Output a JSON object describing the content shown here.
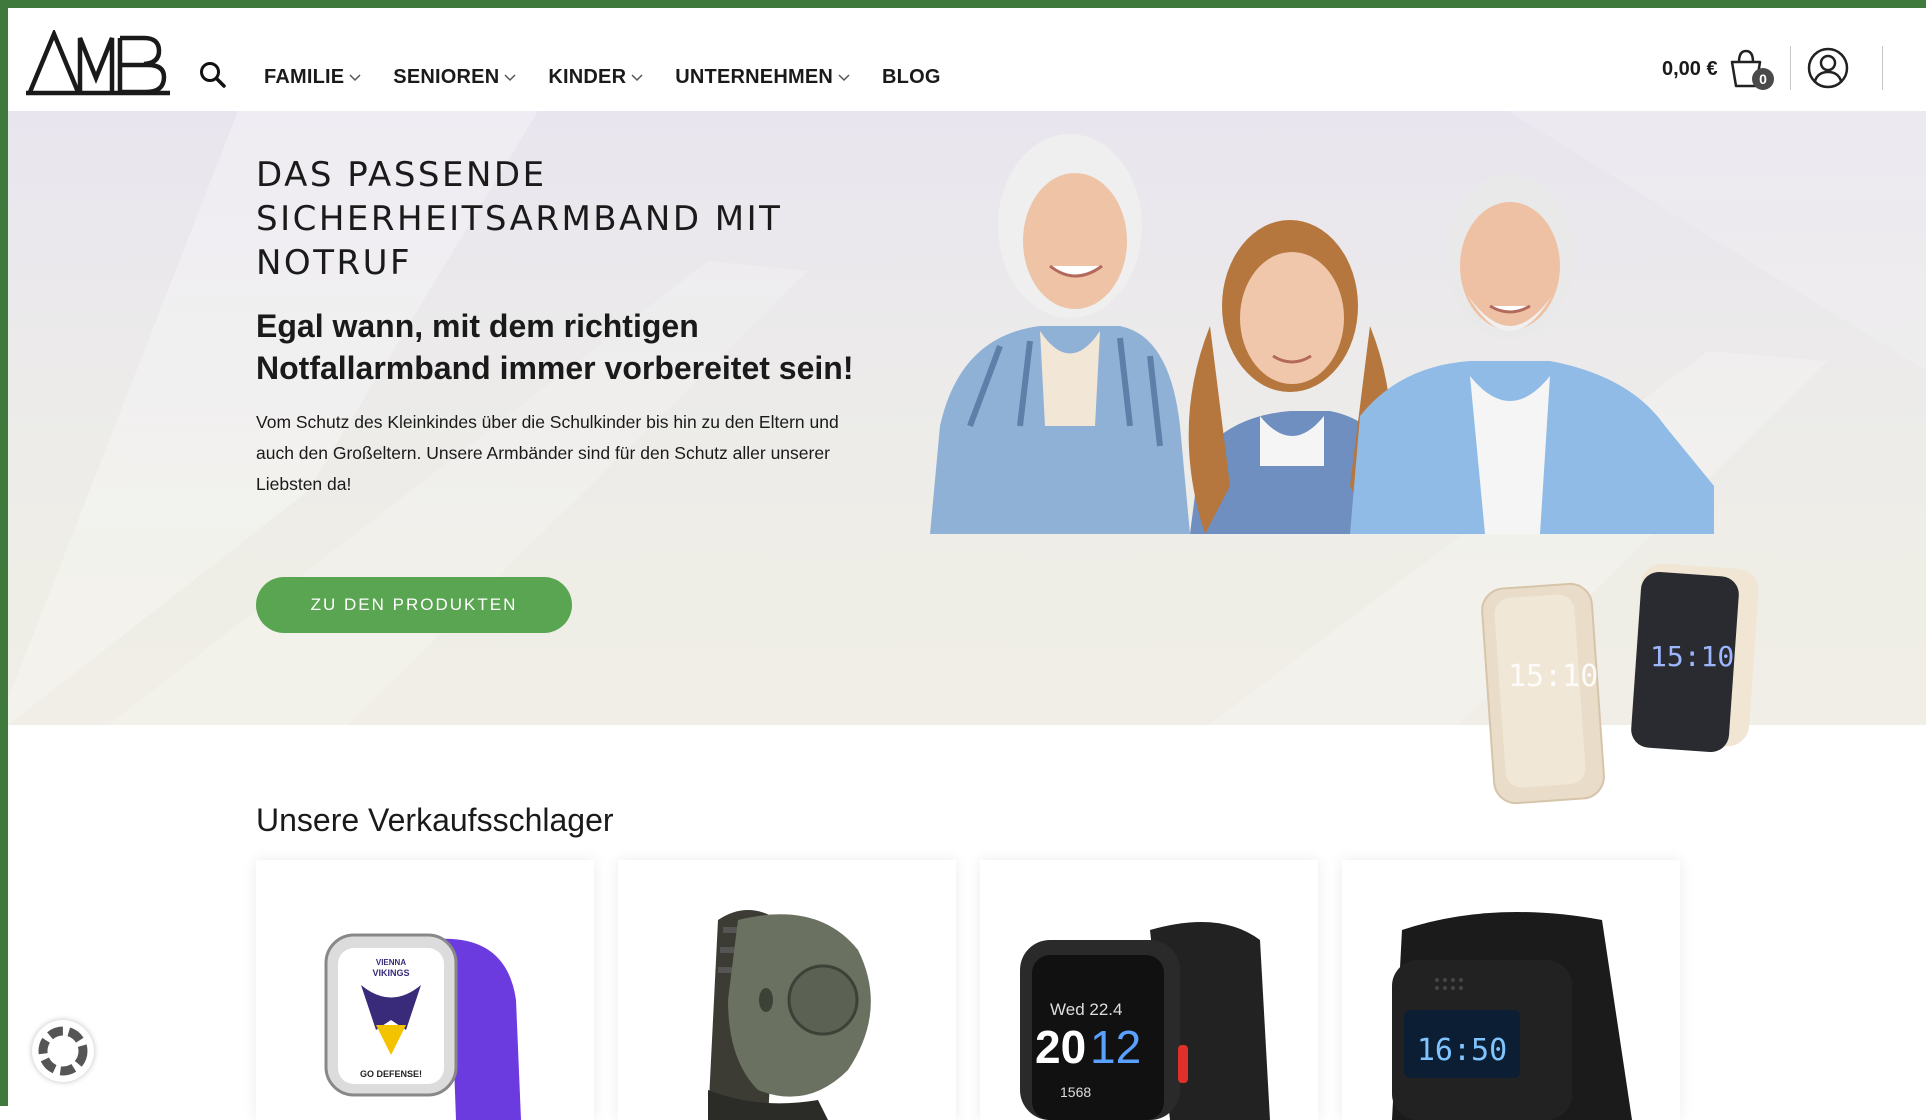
{
  "header": {
    "logo_text": "AMB",
    "nav": [
      {
        "label": "FAMILIE",
        "has_dropdown": true
      },
      {
        "label": "SENIOREN",
        "has_dropdown": true
      },
      {
        "label": "KINDER",
        "has_dropdown": true
      },
      {
        "label": "UNTERNEHMEN",
        "has_dropdown": true
      },
      {
        "label": "BLOG",
        "has_dropdown": false
      }
    ],
    "cart": {
      "price": "0,00 €",
      "count": "0",
      "icon": "cart-icon"
    },
    "account_icon": "user-circle-icon",
    "search_icon": "search-icon"
  },
  "hero": {
    "title": "DAS PASSENDE SICHERHEITSARMBAND MIT NOTRUF",
    "subtitle": "Egal wann, mit dem richtigen Notfallarmband immer vorbereitet sein!",
    "text": "Vom Schutz des Kleinkindes über die Schulkinder bis hin zu den Eltern und auch den Großeltern. Unsere Armbänder sind für den Schutz aller unserer Liebsten da!",
    "cta_label": "ZU DEN PRODUKTEN",
    "band_display": "15:10"
  },
  "section": {
    "title": "Unsere Verkaufsschlager",
    "products": [
      {
        "watch_top": "VIENNA",
        "watch_brand": "VIKINGS",
        "watch_bottom": "GO DEFENSE!"
      },
      {
        "device": "olive-emergency-button"
      },
      {
        "watch_date": "Wed 22.4",
        "watch_time_h": "20",
        "watch_time_m": "12",
        "watch_steps": "1568"
      },
      {
        "watch_time": "16:50"
      }
    ]
  },
  "colors": {
    "accent_green": "#5aa552",
    "frame_green": "#3f7a3c",
    "text": "#1a1a1a"
  }
}
